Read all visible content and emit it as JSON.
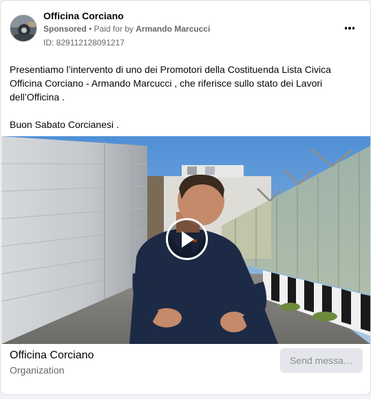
{
  "header": {
    "page_name": "Officina Corciano",
    "sponsored_label": "Sponsored",
    "separator": " • ",
    "paid_for_prefix": "Paid for by ",
    "payer": "Armando Marcucci",
    "ad_id": "ID: 829112128091217"
  },
  "icons": {
    "menu": "more-icon",
    "play": "play-icon",
    "avatar": "avatar"
  },
  "post": {
    "paragraph_1": "Presentiamo l’intervento di uno dei Promotori della Costituenda Lista Civica Officina Corciano - Armando Marcucci , che riferisce sullo stato dei Lavori dell’Officina .",
    "paragraph_2": "Buon Sabato Corcianesi ."
  },
  "footer": {
    "org_name": "Officina Corciano",
    "org_type": "Organization",
    "send_button_label": "Send messa…"
  },
  "colors": {
    "secondary_text": "#65676b",
    "button_bg": "#e4e6eb",
    "card_border": "#dddfe2"
  }
}
